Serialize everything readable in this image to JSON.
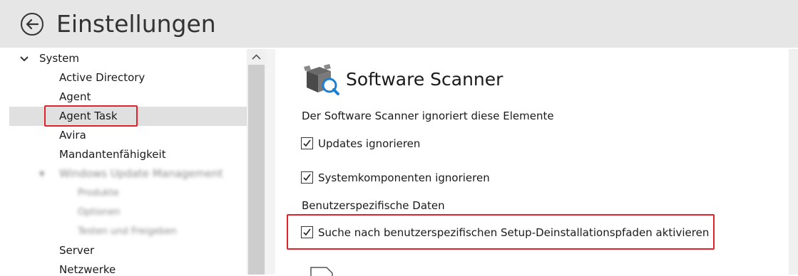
{
  "header": {
    "title": "Einstellungen",
    "back_icon": "back-arrow-icon"
  },
  "tree": {
    "root": {
      "label": "System",
      "icon": "chevron-down-icon"
    },
    "items": [
      {
        "label": "Active Directory"
      },
      {
        "label": "Agent"
      },
      {
        "label": "Agent Task",
        "selected": true
      },
      {
        "label": "Avira"
      },
      {
        "label": "Mandantenfähigkeit"
      },
      {
        "label": "Windows Update Management",
        "blurred": true
      },
      {
        "label": "Produkte",
        "blurred": true
      },
      {
        "label": "Optionen",
        "blurred": true
      },
      {
        "label": "Testen und Freigeben",
        "blurred": true
      },
      {
        "label": "Server"
      },
      {
        "label": "Netzwerke"
      }
    ]
  },
  "content": {
    "section_icon": "software-scanner-icon",
    "section_title": "Software Scanner",
    "ignore_heading": "Der Software Scanner ignoriert diese Elemente",
    "options": [
      {
        "label": "Updates ignorieren",
        "checked": true
      },
      {
        "label": "Systemkomponenten ignorieren",
        "checked": true
      }
    ],
    "user_heading": "Benutzerspezifische Daten",
    "user_option": {
      "label": "Suche nach benutzerspezifischen Setup-Deinstallationspfaden aktivieren",
      "checked": true
    }
  },
  "colors": {
    "highlight": "#e0222a",
    "header_bg": "#e6e6e6",
    "selection_bg": "#e0e0e0"
  }
}
